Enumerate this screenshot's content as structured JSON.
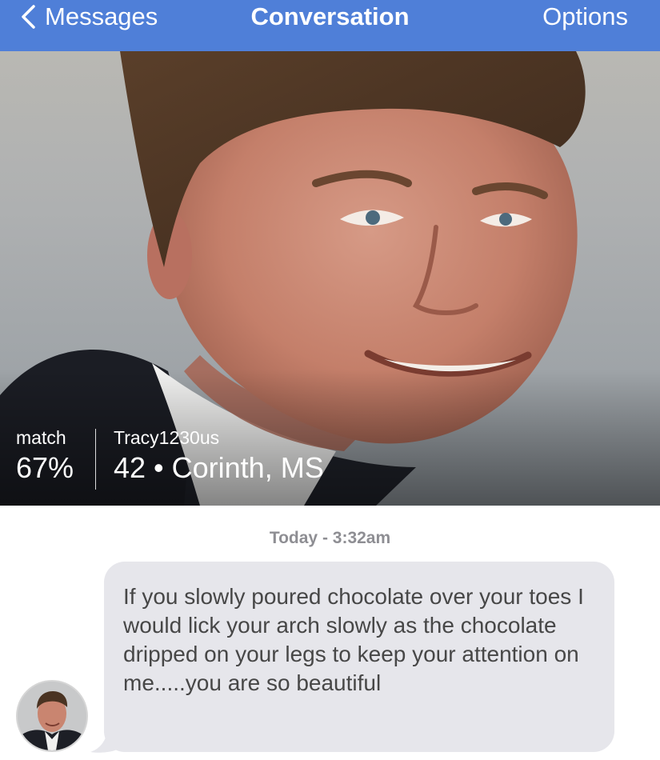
{
  "nav": {
    "back_label": "Messages",
    "title": "Conversation",
    "options_label": "Options",
    "back_icon": "chevron-left-icon",
    "bar_color": "#4f7fd8"
  },
  "profile": {
    "match_label": "match",
    "match_value": "67%",
    "username": "Tracy1230us",
    "details": "42 • Corinth, MS"
  },
  "conversation": {
    "timestamp": "Today - 3:32am",
    "messages": [
      {
        "text": "If you slowly poured chocolate over your toes I would lick your arch slowly as the chocolate dripped on your legs to keep your attention on me.....you are so beautiful",
        "bubble_color": "#e6e6eb"
      }
    ]
  }
}
